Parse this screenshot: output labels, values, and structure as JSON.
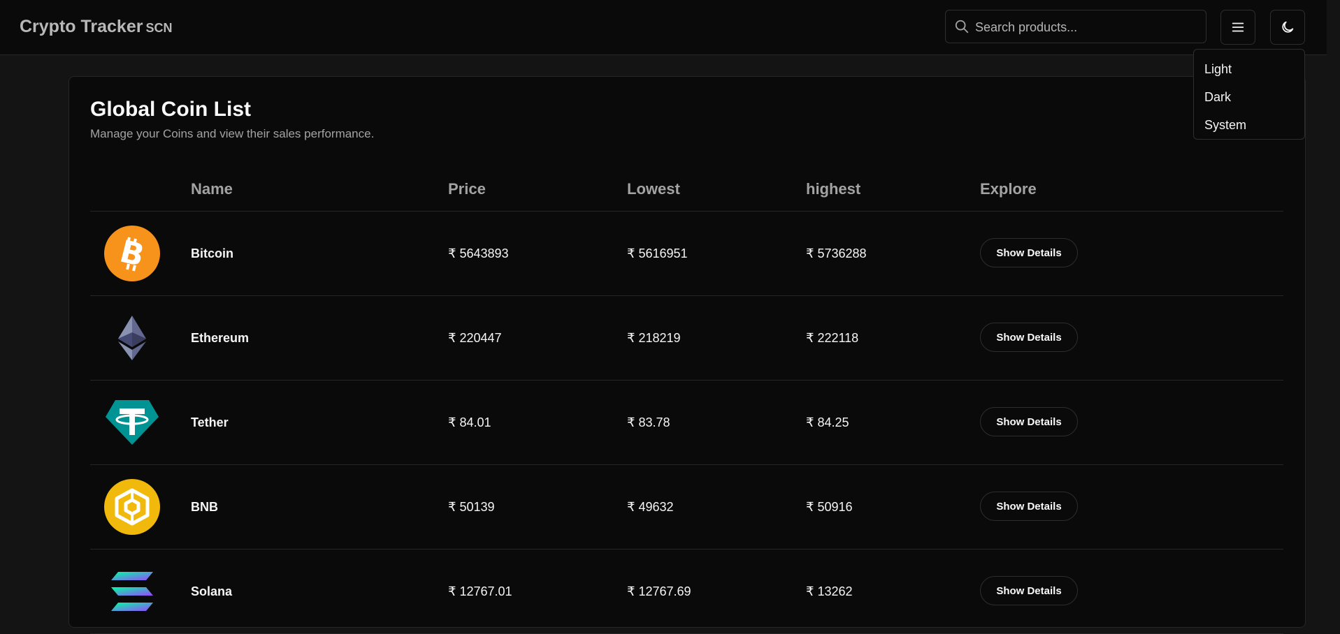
{
  "app": {
    "brand": "Crypto Tracker",
    "brand_abbr": "SCN"
  },
  "search": {
    "placeholder": "Search products...",
    "value": ""
  },
  "theme_menu": {
    "options": [
      "Light",
      "Dark",
      "System"
    ]
  },
  "page": {
    "title": "Global Coin List",
    "subtitle": "Manage your Coins and view their sales performance."
  },
  "table": {
    "headers": {
      "name": "Name",
      "price": "Price",
      "lowest": "Lowest",
      "highest": "highest",
      "explore": "Explore"
    },
    "rows": [
      {
        "name": "Bitcoin",
        "price": "₹ 5643893",
        "lowest": "₹ 5616951",
        "highest": "₹ 5736288",
        "action": "Show Details",
        "logo_icon": "bitcoin-logo-icon"
      },
      {
        "name": "Ethereum",
        "price": "₹ 220447",
        "lowest": "₹ 218219",
        "highest": "₹ 222118",
        "action": "Show Details",
        "logo_icon": "ethereum-logo-icon"
      },
      {
        "name": "Tether",
        "price": "₹ 84.01",
        "lowest": "₹ 83.78",
        "highest": "₹ 84.25",
        "action": "Show Details",
        "logo_icon": "tether-logo-icon"
      },
      {
        "name": "BNB",
        "price": "₹ 50139",
        "lowest": "₹ 49632",
        "highest": "₹ 50916",
        "action": "Show Details",
        "logo_icon": "bnb-logo-icon"
      },
      {
        "name": "Solana",
        "price": "₹ 12767.01",
        "lowest": "₹ 12767.69",
        "highest": "₹ 13262",
        "action": "Show Details",
        "logo_icon": "solana-logo-icon"
      }
    ]
  },
  "colors": {
    "bitcoin": "#f7931a",
    "tether": "#009393",
    "bnb": "#f0b90b",
    "ethereum": "#62688f"
  }
}
